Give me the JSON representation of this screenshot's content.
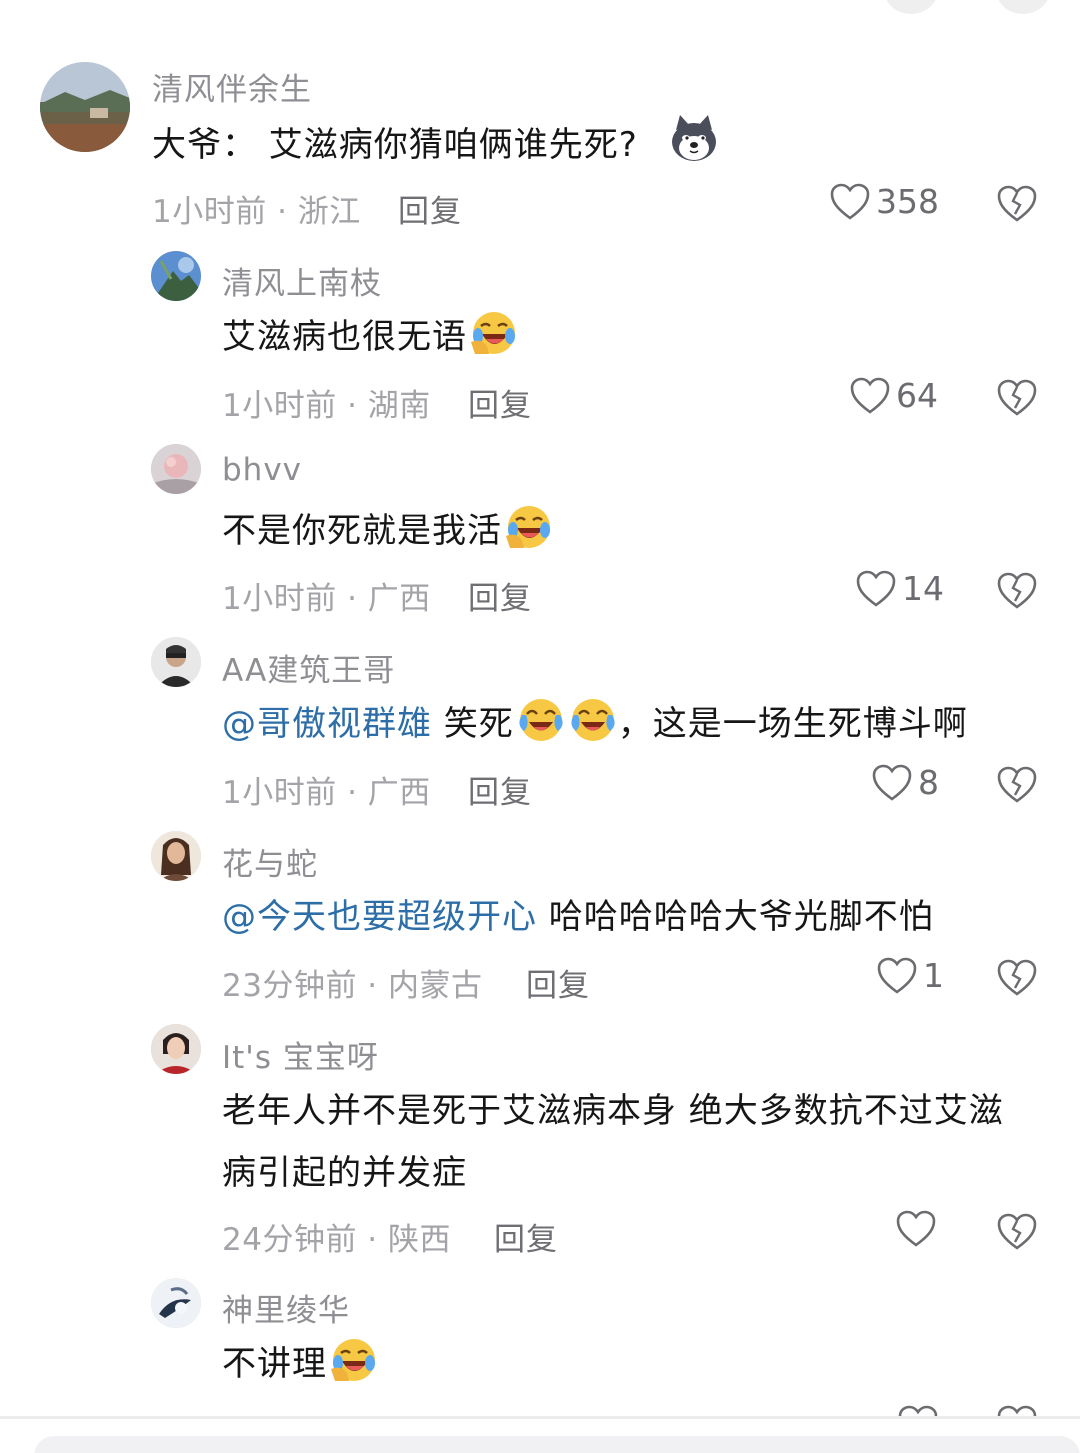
{
  "comments": [
    {
      "username": "清风伴余生",
      "text": "大爷：  艾滋病你猜咱俩谁先死?",
      "emoji": "husky-doge-emoji",
      "time_location": "1小时前 · 浙江",
      "reply_label": "回复",
      "likes": "358"
    },
    {
      "username": "清风上南枝",
      "text": "艾滋病也很无语",
      "emoji": "laugh-cry-emoji",
      "time_location": "1小时前 · 湖南",
      "reply_label": "回复",
      "likes": "64"
    },
    {
      "username": "bhvv",
      "text": "不是你死就是我活",
      "emoji": "laugh-cry-emoji",
      "time_location": "1小时前 · 广西",
      "reply_label": "回复",
      "likes": "14"
    },
    {
      "username": "AA建筑王哥",
      "mention": "@哥傲视群雄",
      "text_before": " 笑死",
      "text_after": "，这是一场生死博斗啊",
      "emoji": "tears-of-joy-emoji",
      "time_location": "1小时前 · 广西",
      "reply_label": "回复",
      "likes": "8"
    },
    {
      "username": "花与蛇",
      "mention": "@今天也要超级开心",
      "text": " 哈哈哈哈哈大爷光脚不怕",
      "time_location": "23分钟前 · 内蒙古",
      "reply_label": "回复",
      "likes": "1"
    },
    {
      "username": "It's 宝宝呀",
      "text": "老年人并不是死于艾滋病本身 绝大多数抗不过艾滋病引起的并发症",
      "time_location": "24分钟前 · 陕西",
      "reply_label": "回复",
      "likes": ""
    },
    {
      "username": "神里绫华",
      "text": "不讲理",
      "emoji": "laugh-cry-emoji",
      "time_location": "",
      "reply_label": "",
      "likes": ""
    }
  ],
  "colors": {
    "mention": "#2d6ea8",
    "meta": "#a3a3a8",
    "username": "#8e8e93"
  },
  "icons": {
    "like": "heart-outline-icon",
    "dislike": "broken-heart-icon"
  }
}
